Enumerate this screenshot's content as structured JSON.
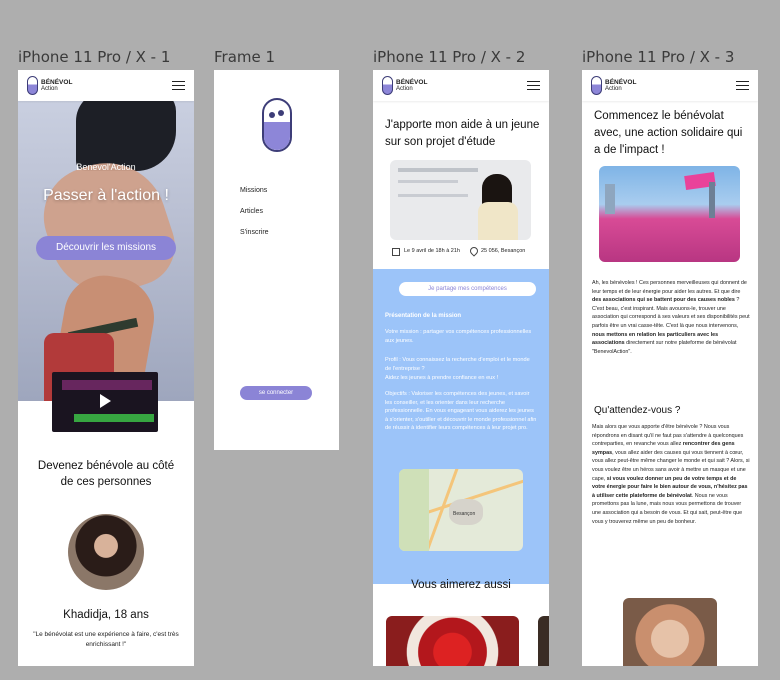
{
  "frames": {
    "f1": {
      "label": "iPhone 11 Pro / X - 1",
      "logo": {
        "name": "BÉNÉVOL",
        "sub": "Action"
      },
      "hero_brand": "Benevol'Action",
      "hero_title": "Passer à l'action !",
      "hero_button": "Découvrir les missions",
      "section_title": "Devenez bénévole au côté de ces personnes",
      "person_name": "Khadidja, 18 ans",
      "quote": "\"Le bénévolat est une expérience à faire, c'est très enrichissant !\""
    },
    "f2": {
      "label": "Frame 1",
      "menu": [
        "Missions",
        "Articles",
        "S'inscrire"
      ],
      "login_button": "se connecter"
    },
    "f3": {
      "label": "iPhone 11 Pro / X - 2",
      "logo": {
        "name": "BÉNÉVOL",
        "sub": "Action"
      },
      "title": "J'apporte mon aide à un jeune sur son projet d'étude",
      "date": "Le 9 avril de 18h à 21h",
      "location": "25 056, Besançon",
      "share_button": "Je partage mes compétences",
      "mission_heading": "Présentation de la mission",
      "mission_text": "Votre mission : partager vos compétences professionnelles aux jeunes.",
      "profile_text": "Profil : Vous connaissez la recherche d'emploi et le monde de l'entreprise ?",
      "help_text": "Aidez les jeunes à prendre confiance en eux !",
      "objective_text": "Objectifs : Valoriser les compétences des jeunes, et savoir les conseiller, et les orienter dans leur recherche professionnelle. En vous engageant vous aiderez les jeunes à s'orienter, s'outiller et découvrir le monde professionnel afin de réussir à identifier leurs compétences à leur projet pro.",
      "map_label": "Besançon",
      "also_like": "Vous aimerez aussi"
    },
    "f4": {
      "label": "iPhone 11 Pro / X - 3",
      "logo": {
        "name": "BÉNÉVOL",
        "sub": "Action"
      },
      "title": "Commencez le bénévolat avec, une action solidaire qui a de l'impact !",
      "p1_a": "Ah, les bénévoles ! Ces personnes merveilleuses qui donnent de leur temps et de leur énergie pour aider les autres. Et que dire ",
      "p1_b": "des associations qui se battent pour des causes nobles",
      "p1_c": " ? C'est beau, c'est inspirant. Mais avouons-le, trouver une association qui correspond à ses valeurs et ses disponibilités peut parfois être un vrai casse-tête. C'est là que nous intervenons, ",
      "p1_d": "nous mettons en relation les particuliers avec les associations",
      "p1_e": " directement sur notre plateforme de bénévolat \"BenevolAction\".",
      "h2": "Qu'attendez-vous ?",
      "p2_a": "Mais alors que vous apporte d'être bénévole ? Nous vous répondrons en disant qu'il ne faut pas s'attendre à quelconques contreparties, en revanche vous allez ",
      "p2_b": "rencontrer des gens sympas",
      "p2_c": ", vous allez aider des causes qui vous tiennent à cœur, vous allez peut-être même changer le monde et qui sait ? Alors, si vous voulez être un héros sans avoir à mettre un masque et une cape, ",
      "p2_d": "si vous voulez donner un peu de votre temps et de votre énergie pour faire le bien autour de vous, n'hésitez pas à utiliser cette plateforme de bénévolat",
      "p2_e": ". Nous ne vous promettons pas la lune, mais nous vous permettons de trouver une association qui a besoin de vous. Et qui sait, peut-être que vous y trouverez même un peu de bonheur."
    }
  },
  "colors": {
    "accent": "#8b84d6",
    "light_blue": "#9cc4f9",
    "background": "#aeaeae"
  }
}
